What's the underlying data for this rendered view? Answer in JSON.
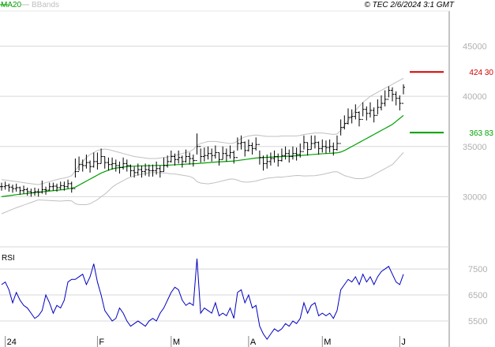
{
  "header": {
    "legend_ma": "MA20",
    "legend_bb": "BBands",
    "timestamp": "© TEC 2/6/2024 3:1 GMT"
  },
  "colors": {
    "price": "#000000",
    "ma": "#00a000",
    "bbands": "#c0c0c0",
    "rsi": "#0000c0",
    "resistance": "#d00000",
    "support": "#00a000",
    "grid": "#d8d8d8",
    "axis": "#888888"
  },
  "chart_data": [
    {
      "type": "candlestick",
      "panel": "price",
      "y_ticks": [
        30000,
        35000,
        40000,
        45000
      ],
      "y_tick_labels": [
        "30000",
        "35000",
        "40000",
        "45000"
      ],
      "ylim": [
        25000,
        48500
      ],
      "x_ticks": [
        {
          "index": 1,
          "label": "24"
        },
        {
          "index": 26,
          "label": "F"
        },
        {
          "index": 46,
          "label": "M"
        },
        {
          "index": 67,
          "label": "A"
        },
        {
          "index": 87,
          "label": "M"
        },
        {
          "index": 108,
          "label": "J"
        }
      ],
      "levels": [
        {
          "label": "424 30",
          "value": 42430,
          "color": "resistance"
        },
        {
          "label": "363 83",
          "value": 36383,
          "color": "support"
        }
      ],
      "close": [
        31000,
        31100,
        30950,
        30800,
        30900,
        30600,
        30700,
        30500,
        30400,
        30500,
        30450,
        30700,
        30650,
        31000,
        31050,
        30900,
        31100,
        31000,
        31300,
        30800,
        32500,
        33200,
        33100,
        33400,
        33000,
        33500,
        33300,
        34000,
        33400,
        33200,
        33300,
        33100,
        32900,
        33300,
        33100,
        32600,
        32400,
        32700,
        32500,
        32700,
        32600,
        32600,
        32800,
        32500,
        33100,
        33500,
        34000,
        33700,
        33900,
        33500,
        34000,
        33800,
        33600,
        35000,
        34000,
        34100,
        34300,
        34100,
        34400,
        33700,
        34300,
        34100,
        34400,
        33900,
        35300,
        35400,
        34600,
        35100,
        34800,
        35200,
        33900,
        33300,
        33500,
        33800,
        34000,
        33600,
        34100,
        34300,
        34000,
        34300,
        34200,
        34500,
        35400,
        34700,
        35300,
        35400,
        34800,
        35000,
        34900,
        35000,
        34700,
        35300,
        36900,
        37300,
        37900,
        38000,
        38400,
        37700,
        38700,
        38300,
        38600,
        38100,
        38900,
        39300,
        39700,
        40600,
        40200,
        39800,
        39300,
        40900
      ],
      "high": [
        31400,
        31500,
        31300,
        31200,
        31300,
        31000,
        31100,
        30900,
        30800,
        30900,
        30800,
        31600,
        31000,
        31400,
        31400,
        31300,
        31500,
        31500,
        31700,
        31500,
        33800,
        34000,
        33700,
        34200,
        33600,
        34400,
        34400,
        34800,
        34000,
        33900,
        33900,
        33700,
        33500,
        33900,
        33700,
        33200,
        33000,
        33300,
        33100,
        33300,
        33200,
        33200,
        33500,
        33100,
        33900,
        34100,
        34600,
        34300,
        34600,
        34100,
        34700,
        34400,
        34200,
        36300,
        34800,
        34900,
        35000,
        34800,
        35100,
        34400,
        35000,
        34800,
        35100,
        34600,
        35900,
        36100,
        35500,
        35700,
        35400,
        35900,
        34600,
        34100,
        34200,
        34400,
        34600,
        34300,
        34800,
        35000,
        34700,
        35000,
        34900,
        35300,
        36100,
        35400,
        36100,
        36100,
        35500,
        35700,
        35600,
        35700,
        35400,
        36100,
        37700,
        38100,
        38800,
        38700,
        39200,
        38500,
        39400,
        39000,
        39400,
        38900,
        39700,
        40100,
        40600,
        41000,
        40900,
        40500,
        40100,
        41200
      ],
      "low": [
        30600,
        30700,
        30500,
        30400,
        30500,
        30200,
        30300,
        30100,
        30000,
        30100,
        30000,
        30300,
        30200,
        30600,
        30600,
        30500,
        30700,
        30600,
        30800,
        30400,
        31900,
        32600,
        32500,
        32800,
        32400,
        32900,
        32700,
        33300,
        32800,
        32600,
        32700,
        32500,
        32300,
        32700,
        32500,
        32000,
        31900,
        32100,
        31900,
        32100,
        32000,
        32000,
        32200,
        31900,
        32500,
        32900,
        33400,
        33100,
        33300,
        32900,
        33400,
        33200,
        33000,
        34200,
        33400,
        33500,
        33700,
        33500,
        33800,
        33100,
        33700,
        33500,
        33800,
        33300,
        34600,
        34700,
        34000,
        34500,
        34200,
        34600,
        33200,
        32600,
        32800,
        33100,
        33400,
        33000,
        33500,
        33700,
        33400,
        33700,
        33600,
        33900,
        34700,
        34100,
        34700,
        34800,
        34200,
        34400,
        34300,
        34400,
        34100,
        34600,
        36100,
        36700,
        37200,
        37300,
        37700,
        37000,
        38000,
        37600,
        37900,
        37400,
        38200,
        38600,
        39000,
        39900,
        39500,
        39100,
        38600,
        40200
      ],
      "ma20": [
        30000,
        30050,
        30100,
        30150,
        30200,
        30240,
        30280,
        30320,
        30360,
        30400,
        30440,
        30480,
        30520,
        30560,
        30600,
        30640,
        30680,
        30720,
        30780,
        30840,
        30950,
        31150,
        31350,
        31550,
        31750,
        31950,
        32150,
        32350,
        32500,
        32640,
        32770,
        32850,
        32900,
        32950,
        33000,
        33020,
        33040,
        33060,
        33070,
        33080,
        33090,
        33100,
        33110,
        33120,
        33130,
        33140,
        33160,
        33180,
        33200,
        33220,
        33240,
        33260,
        33280,
        33300,
        33330,
        33360,
        33390,
        33420,
        33450,
        33470,
        33490,
        33510,
        33530,
        33550,
        33600,
        33650,
        33700,
        33750,
        33800,
        33850,
        33880,
        33900,
        33920,
        33940,
        33960,
        33980,
        34000,
        34020,
        34040,
        34060,
        34080,
        34100,
        34130,
        34160,
        34190,
        34220,
        34250,
        34280,
        34300,
        34320,
        34340,
        34370,
        34450,
        34600,
        34800,
        35000,
        35200,
        35400,
        35600,
        35800,
        36000,
        36200,
        36400,
        36600,
        36800,
        37000,
        37200,
        37500,
        37800,
        38100
      ],
      "bb_upper": [
        31700,
        31650,
        31600,
        31550,
        31500,
        31450,
        31400,
        31350,
        31300,
        31250,
        31200,
        31300,
        31400,
        31500,
        31600,
        31700,
        31800,
        31850,
        31950,
        32100,
        32600,
        33100,
        33500,
        33900,
        34200,
        34400,
        34600,
        34700,
        34750,
        34700,
        34600,
        34500,
        34400,
        34300,
        34200,
        34100,
        34000,
        33950,
        33900,
        33850,
        33800,
        33800,
        33800,
        33850,
        33900,
        33950,
        34050,
        34100,
        34200,
        34300,
        34400,
        34500,
        34700,
        35100,
        35300,
        35400,
        35500,
        35500,
        35500,
        35450,
        35400,
        35350,
        35300,
        35350,
        35550,
        35800,
        35950,
        36050,
        36100,
        36150,
        36100,
        36050,
        36000,
        36000,
        36000,
        36000,
        36050,
        36050,
        36050,
        36050,
        36050,
        36100,
        36200,
        36250,
        36300,
        36350,
        36350,
        36350,
        36300,
        36250,
        36200,
        36250,
        36600,
        37100,
        37600,
        38100,
        38600,
        39000,
        39400,
        39700,
        40000,
        40200,
        40400,
        40600,
        40800,
        41000,
        41200,
        41400,
        41600,
        41800
      ],
      "bb_lower": [
        28300,
        28450,
        28600,
        28750,
        28900,
        29030,
        29160,
        29290,
        29420,
        29550,
        29680,
        29660,
        29640,
        29620,
        29600,
        29580,
        29560,
        29590,
        29610,
        29580,
        29300,
        29200,
        29200,
        29200,
        29300,
        29500,
        29700,
        30000,
        30250,
        30580,
        30940,
        31200,
        31400,
        31600,
        31800,
        31940,
        32080,
        32170,
        32240,
        32310,
        32380,
        32400,
        32420,
        32390,
        32360,
        32330,
        32270,
        32260,
        32200,
        32140,
        32080,
        32020,
        31860,
        31500,
        31360,
        31320,
        31280,
        31340,
        31400,
        31490,
        31580,
        31670,
        31760,
        31750,
        31650,
        31500,
        31450,
        31450,
        31500,
        31550,
        31660,
        31750,
        31840,
        31880,
        31920,
        31960,
        31950,
        31990,
        32030,
        32070,
        32110,
        32100,
        32060,
        32070,
        32080,
        32090,
        32150,
        32210,
        32300,
        32390,
        32480,
        32490,
        32300,
        32100,
        32000,
        31900,
        31800,
        31800,
        31800,
        31900,
        32000,
        32200,
        32400,
        32600,
        32800,
        33000,
        33200,
        33600,
        34000,
        34400
      ]
    },
    {
      "type": "line",
      "panel": "rsi",
      "title": "RSI",
      "y_ticks": [
        55,
        65,
        75
      ],
      "y_tick_labels": [
        "5500",
        "6500",
        "7500"
      ],
      "ylim": [
        45,
        82
      ],
      "values": [
        69,
        70,
        67,
        62,
        66,
        63,
        61,
        60,
        58,
        56,
        57,
        59,
        65,
        62,
        58,
        61,
        60,
        63,
        70,
        71,
        71,
        72,
        73,
        69,
        72,
        77,
        70,
        65,
        59,
        57,
        55,
        56,
        60,
        58,
        55,
        53,
        54,
        55,
        54,
        53,
        55,
        56,
        55,
        58,
        60,
        63,
        66,
        68,
        67,
        63,
        61,
        62,
        61,
        79,
        58,
        60,
        59,
        58,
        62,
        57,
        58,
        57,
        60,
        56,
        66,
        67,
        62,
        65,
        60,
        61,
        53,
        50,
        48,
        50,
        52,
        51,
        52,
        54,
        53,
        55,
        54,
        56,
        62,
        58,
        61,
        62,
        57,
        58,
        57,
        58,
        56,
        59,
        67,
        69,
        71,
        70,
        72,
        69,
        73,
        70,
        72,
        69,
        72,
        74,
        75,
        76,
        73,
        70,
        69,
        73
      ]
    }
  ]
}
